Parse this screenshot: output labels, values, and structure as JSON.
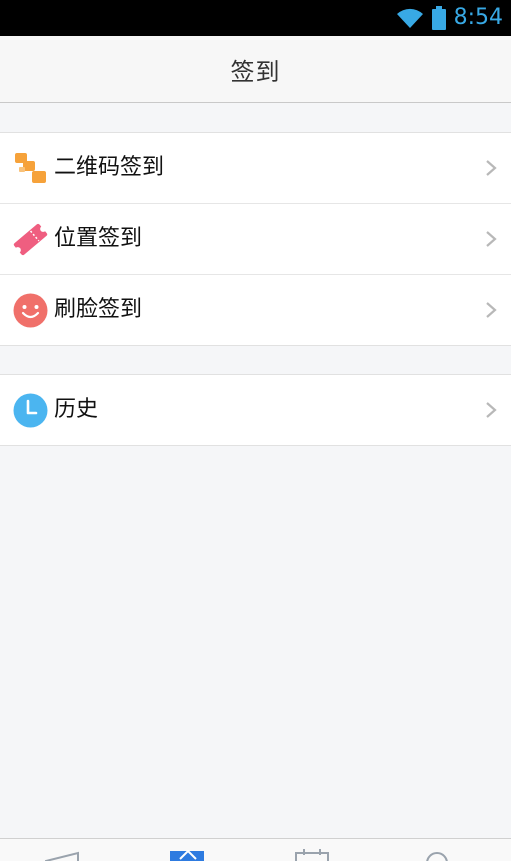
{
  "status_bar": {
    "time": "8:54"
  },
  "header": {
    "title": "签到"
  },
  "menu": {
    "items": [
      {
        "label": "二维码签到",
        "icon": "qr-code-icon"
      },
      {
        "label": "位置签到",
        "icon": "ticket-icon"
      },
      {
        "label": "刷脸签到",
        "icon": "smiley-face-icon"
      }
    ]
  },
  "history": {
    "label": "历史",
    "icon": "clock-icon"
  },
  "colors": {
    "qr_icon": "#f6a23a",
    "ticket_icon": "#ef5e80",
    "face_icon": "#f0706a",
    "clock_icon": "#4bb5f0",
    "status_accent": "#38a9e5",
    "tab_active": "#2e7be0"
  }
}
